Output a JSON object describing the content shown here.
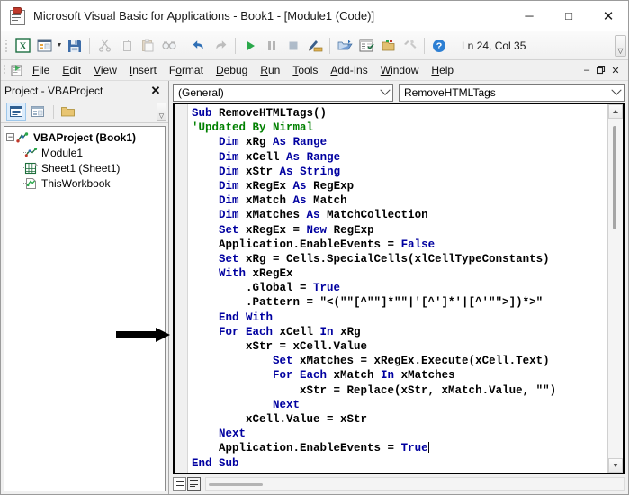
{
  "window": {
    "title": "Microsoft Visual Basic for Applications - Book1 - [Module1 (Code)]",
    "icon": "vba-app-icon",
    "minimize_label": "─",
    "maximize_label": "□",
    "close_label": "✕"
  },
  "toolbar": {
    "position_text": "Ln 24, Col 35",
    "overflow_label": "▾",
    "buttons": [
      {
        "name": "view-excel-icon",
        "tip": "View Microsoft Excel"
      },
      {
        "name": "insert-userform-icon",
        "tip": "Insert UserForm"
      },
      {
        "name": "insert-dropdown-icon",
        "tip": "Insert"
      },
      {
        "name": "save-icon",
        "tip": "Save Book1"
      },
      {
        "name": "cut-icon",
        "tip": "Cut"
      },
      {
        "name": "copy-icon",
        "tip": "Copy"
      },
      {
        "name": "paste-icon",
        "tip": "Paste"
      },
      {
        "name": "find-icon",
        "tip": "Find"
      },
      {
        "name": "undo-icon",
        "tip": "Undo"
      },
      {
        "name": "redo-icon",
        "tip": "Redo"
      },
      {
        "name": "run-icon",
        "tip": "Run Sub/UserForm"
      },
      {
        "name": "break-icon",
        "tip": "Break"
      },
      {
        "name": "reset-icon",
        "tip": "Reset"
      },
      {
        "name": "design-mode-icon",
        "tip": "Design Mode"
      },
      {
        "name": "project-explorer-icon",
        "tip": "Project Explorer"
      },
      {
        "name": "properties-window-icon",
        "tip": "Properties Window"
      },
      {
        "name": "object-browser-icon",
        "tip": "Object Browser"
      },
      {
        "name": "toolbox-icon",
        "tip": "Toolbox"
      },
      {
        "name": "help-icon",
        "tip": "Help"
      }
    ]
  },
  "menubar": {
    "app_icon": "vba-small-icon",
    "items": [
      {
        "pre": "",
        "key": "F",
        "post": "ile"
      },
      {
        "pre": "",
        "key": "E",
        "post": "dit"
      },
      {
        "pre": "",
        "key": "V",
        "post": "iew"
      },
      {
        "pre": "",
        "key": "I",
        "post": "nsert"
      },
      {
        "pre": "",
        "key": "F",
        "post": "ormat"
      },
      {
        "pre": "",
        "key": "D",
        "post": "ebug"
      },
      {
        "pre": "",
        "key": "R",
        "post": "un"
      },
      {
        "pre": "",
        "key": "T",
        "post": "ools"
      },
      {
        "pre": "",
        "key": "A",
        "post": "dd-Ins"
      },
      {
        "pre": "",
        "key": "W",
        "post": "indow"
      },
      {
        "pre": "",
        "key": "H",
        "post": "elp"
      }
    ],
    "mdi_minimize": "–",
    "mdi_restore": "❐",
    "mdi_close": "✕"
  },
  "project_explorer": {
    "title": "Project - VBAProject",
    "close_label": "✕",
    "toolbar": [
      {
        "name": "view-code-button",
        "label": "View Code"
      },
      {
        "name": "view-object-button",
        "label": "View Object"
      },
      {
        "name": "toggle-folders-button",
        "label": "Toggle Folders"
      }
    ],
    "overflow_label": "▾",
    "tree": {
      "root": {
        "label": "VBAProject (Book1)",
        "icon": "vbaproject-icon",
        "expander": "−"
      },
      "children": [
        {
          "label": "Module1",
          "icon": "module-icon"
        },
        {
          "label": "Sheet1 (Sheet1)",
          "icon": "worksheet-icon"
        },
        {
          "label": "ThisWorkbook",
          "icon": "workbook-icon"
        }
      ]
    }
  },
  "code_pane": {
    "object_combo": "(General)",
    "procedure_combo": "RemoveHTMLTags",
    "lines": [
      {
        "indent": 0,
        "segs": [
          {
            "t": "Sub",
            "c": "kw"
          },
          {
            "t": " RemoveHTMLTags()",
            "c": "id"
          }
        ]
      },
      {
        "indent": 0,
        "segs": [
          {
            "t": "'Updated By Nirmal",
            "c": "cm"
          }
        ]
      },
      {
        "indent": 1,
        "segs": [
          {
            "t": "Dim",
            "c": "kw"
          },
          {
            "t": " xRg ",
            "c": "id"
          },
          {
            "t": "As",
            "c": "kw"
          },
          {
            "t": " ",
            "c": "id"
          },
          {
            "t": "Range",
            "c": "kw"
          }
        ]
      },
      {
        "indent": 1,
        "segs": [
          {
            "t": "Dim",
            "c": "kw"
          },
          {
            "t": " xCell ",
            "c": "id"
          },
          {
            "t": "As",
            "c": "kw"
          },
          {
            "t": " ",
            "c": "id"
          },
          {
            "t": "Range",
            "c": "kw"
          }
        ]
      },
      {
        "indent": 1,
        "segs": [
          {
            "t": "Dim",
            "c": "kw"
          },
          {
            "t": " xStr ",
            "c": "id"
          },
          {
            "t": "As",
            "c": "kw"
          },
          {
            "t": " ",
            "c": "id"
          },
          {
            "t": "String",
            "c": "kw"
          }
        ]
      },
      {
        "indent": 1,
        "segs": [
          {
            "t": "Dim",
            "c": "kw"
          },
          {
            "t": " xRegEx ",
            "c": "id"
          },
          {
            "t": "As",
            "c": "kw"
          },
          {
            "t": " RegExp",
            "c": "id"
          }
        ]
      },
      {
        "indent": 1,
        "segs": [
          {
            "t": "Dim",
            "c": "kw"
          },
          {
            "t": " xMatch ",
            "c": "id"
          },
          {
            "t": "As",
            "c": "kw"
          },
          {
            "t": " Match",
            "c": "id"
          }
        ]
      },
      {
        "indent": 1,
        "segs": [
          {
            "t": "Dim",
            "c": "kw"
          },
          {
            "t": " xMatches ",
            "c": "id"
          },
          {
            "t": "As",
            "c": "kw"
          },
          {
            "t": " MatchCollection",
            "c": "id"
          }
        ]
      },
      {
        "indent": 1,
        "segs": [
          {
            "t": "Set",
            "c": "kw"
          },
          {
            "t": " xRegEx = ",
            "c": "id"
          },
          {
            "t": "New",
            "c": "kw"
          },
          {
            "t": " RegExp",
            "c": "id"
          }
        ]
      },
      {
        "indent": 1,
        "segs": [
          {
            "t": "Application.EnableEvents = ",
            "c": "id"
          },
          {
            "t": "False",
            "c": "kw"
          }
        ]
      },
      {
        "indent": 1,
        "segs": [
          {
            "t": "Set",
            "c": "kw"
          },
          {
            "t": " xRg = Cells.SpecialCells(xlCellTypeConstants)",
            "c": "id"
          }
        ]
      },
      {
        "indent": 1,
        "segs": [
          {
            "t": "With",
            "c": "kw"
          },
          {
            "t": " xRegEx",
            "c": "id"
          }
        ]
      },
      {
        "indent": 2,
        "segs": [
          {
            "t": ".Global = ",
            "c": "id"
          },
          {
            "t": "True",
            "c": "kw"
          }
        ]
      },
      {
        "indent": 2,
        "segs": [
          {
            "t": ".Pattern = \"<(\"\"[^\"\"]*\"\"|'[^']*'|[^'\"\">])*>\"",
            "c": "id"
          }
        ]
      },
      {
        "indent": 1,
        "segs": [
          {
            "t": "End With",
            "c": "kw"
          }
        ]
      },
      {
        "indent": 1,
        "segs": [
          {
            "t": "For Each",
            "c": "kw"
          },
          {
            "t": " xCell ",
            "c": "id"
          },
          {
            "t": "In",
            "c": "kw"
          },
          {
            "t": " xRg",
            "c": "id"
          }
        ]
      },
      {
        "indent": 2,
        "segs": [
          {
            "t": "xStr = xCell.Value",
            "c": "id"
          }
        ]
      },
      {
        "indent": 3,
        "segs": [
          {
            "t": "Set",
            "c": "kw"
          },
          {
            "t": " xMatches = xRegEx.Execute(xCell.Text)",
            "c": "id"
          }
        ]
      },
      {
        "indent": 3,
        "segs": [
          {
            "t": "For Each",
            "c": "kw"
          },
          {
            "t": " xMatch ",
            "c": "id"
          },
          {
            "t": "In",
            "c": "kw"
          },
          {
            "t": " xMatches",
            "c": "id"
          }
        ]
      },
      {
        "indent": 4,
        "segs": [
          {
            "t": "xStr = Replace(xStr, xMatch.Value, \"\")",
            "c": "id"
          }
        ]
      },
      {
        "indent": 3,
        "segs": [
          {
            "t": "Next",
            "c": "kw"
          }
        ]
      },
      {
        "indent": 2,
        "segs": [
          {
            "t": "xCell.Value = xStr",
            "c": "id"
          }
        ]
      },
      {
        "indent": 1,
        "segs": [
          {
            "t": "Next",
            "c": "kw"
          }
        ]
      },
      {
        "indent": 1,
        "segs": [
          {
            "t": "Application.EnableEvents = ",
            "c": "id"
          },
          {
            "t": "True",
            "c": "kw"
          }
        ],
        "caret": true
      },
      {
        "indent": 0,
        "segs": [
          {
            "t": "End Sub",
            "c": "kw"
          }
        ]
      }
    ],
    "view_buttons": [
      {
        "name": "procedure-view-button",
        "label": "Procedure View"
      },
      {
        "name": "full-module-view-button",
        "label": "Full Module View"
      }
    ]
  },
  "annotation": {
    "arrow": "right-arrow-annotation"
  },
  "colors": {
    "keyword": "#0000A0",
    "comment": "#008000",
    "identifier": "#000000",
    "code_background": "#FFFFFF",
    "chrome": "#F0F0F0"
  }
}
